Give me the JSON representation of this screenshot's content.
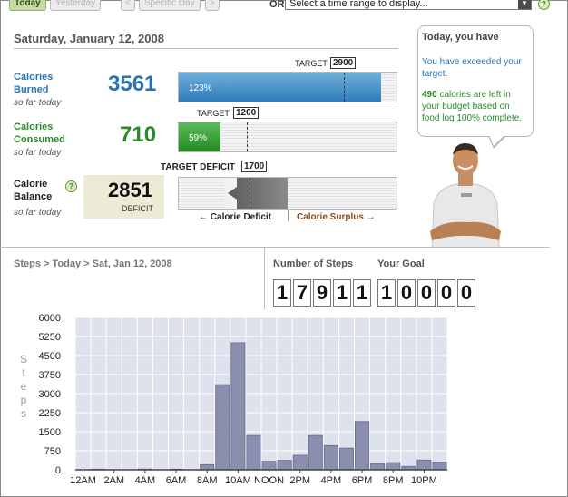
{
  "topbar": {
    "today": "Today",
    "yesterday": "Yesterday",
    "prev": "<",
    "specific_day": "Specific Day",
    "next": ">",
    "or": "OR",
    "range_select": "Select a time range to display..."
  },
  "summary": {
    "date": "Saturday, January 12, 2008",
    "burned": {
      "label_line1": "Calories",
      "label_line2": "Burned",
      "sub": "so far today",
      "value": "3561",
      "target_label": "TARGET",
      "target_value": "2900",
      "percent_text": "123%",
      "fill_fraction": 0.93
    },
    "consumed": {
      "label_line1": "Calories",
      "label_line2": "Consumed",
      "sub": "so far today",
      "value": "710",
      "target_label": "TARGET",
      "target_value": "1200",
      "percent_text": "59%",
      "fill_fraction": 0.19
    },
    "balance": {
      "label_line1": "Calorie",
      "label_line2": "Balance",
      "sub": "so far today",
      "value": "2851",
      "kind": "DEFICIT",
      "target_deficit_label": "TARGET DEFICIT",
      "target_deficit_value": "1700",
      "deficit_axis_label": "Calorie Deficit",
      "surplus_axis_label": "Calorie Surplus"
    }
  },
  "bubble": {
    "title": "Today, you have",
    "line1": "You have exceeded your target.",
    "calories_left": "490",
    "line2_rest": " calories are left in your budget based on food log 100% complete."
  },
  "steps": {
    "breadcrumb": "Steps > Today > Sat, Jan 12, 2008",
    "number_label": "Number of Steps",
    "goal_label": "Your Goal",
    "count_digits": [
      "1",
      "7",
      "9",
      "1",
      "1"
    ],
    "goal_digits": [
      "1",
      "0",
      "0",
      "0",
      "0"
    ]
  },
  "colors": {
    "accent_blue": "#2b73b3",
    "accent_green": "#2b8a2b",
    "bar_fill": "#8a8fb0",
    "plot_bg": "#dde2ec"
  },
  "chart_data": {
    "type": "bar",
    "ylabel": "Steps",
    "ylim": [
      0,
      6000
    ],
    "yticks": [
      0,
      750,
      1500,
      2250,
      3000,
      3750,
      4500,
      5250,
      6000
    ],
    "xticks": [
      "12AM",
      "2AM",
      "4AM",
      "6AM",
      "8AM",
      "10AM",
      "NOON",
      "2PM",
      "4PM",
      "6PM",
      "8PM",
      "10PM"
    ],
    "values": [
      0,
      20,
      0,
      0,
      25,
      0,
      20,
      0,
      200,
      3350,
      5000,
      1350,
      330,
      370,
      570,
      1350,
      950,
      850,
      1900,
      230,
      280,
      130,
      380,
      300
    ],
    "grid": true
  }
}
